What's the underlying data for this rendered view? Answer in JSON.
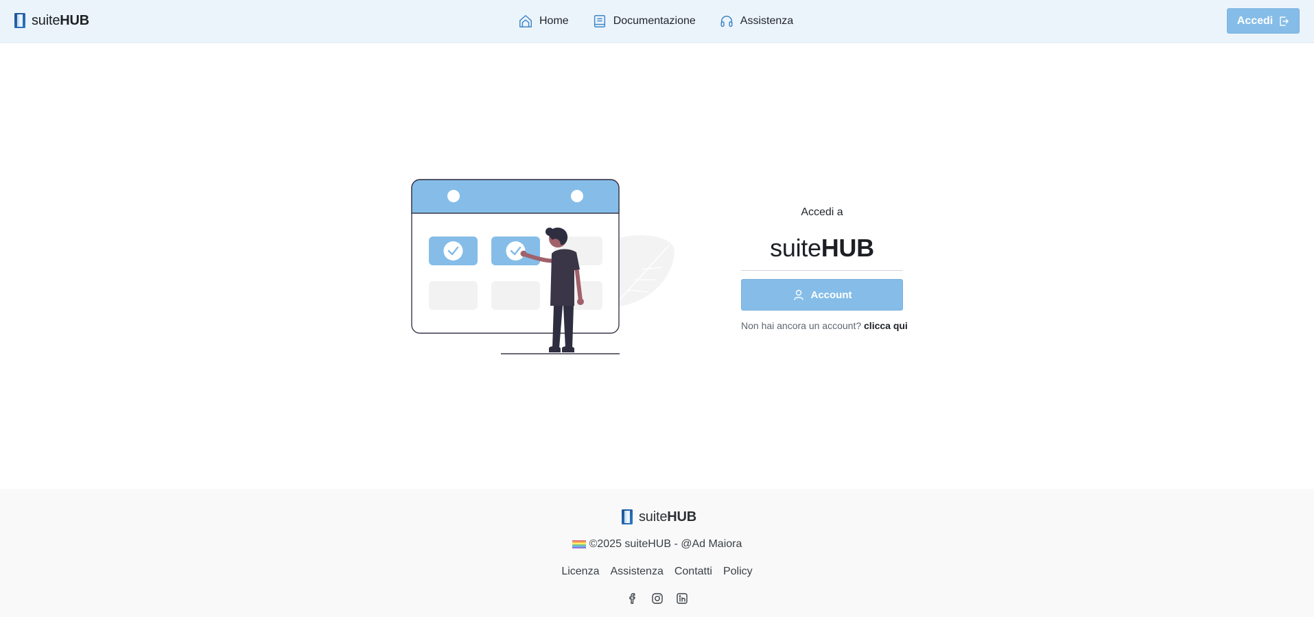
{
  "header": {
    "brand": {
      "name_light": "suite",
      "name_bold": "HUB",
      "icon": "logo-icon"
    },
    "nav": [
      {
        "label": "Home",
        "icon": "home-icon"
      },
      {
        "label": "Documentazione",
        "icon": "book-icon"
      },
      {
        "label": "Assistenza",
        "icon": "headphones-icon"
      }
    ],
    "login_button": {
      "label": "Accedi",
      "icon": "login-icon"
    }
  },
  "login": {
    "subtitle": "Accedi a",
    "title_light": "suite",
    "title_bold": "HUB",
    "account_button": {
      "label": "Account",
      "icon": "user-icon"
    },
    "signup_prompt": "Non hai ancora un account?",
    "signup_link": "clicca qui"
  },
  "footer": {
    "brand": {
      "name_light": "suite",
      "name_bold": "HUB"
    },
    "copyright": "©2025 suiteHUB - @Ad Maiora",
    "links": [
      "Licenza",
      "Assistenza",
      "Contatti",
      "Policy"
    ],
    "social": [
      "facebook-icon",
      "instagram-icon",
      "linkedin-icon"
    ]
  },
  "colors": {
    "accent": "#85bde8",
    "header_bg": "#ecf4fb",
    "footer_bg": "#f9f9f9",
    "figure_dark": "#3a3648",
    "figure_skin": "#a0616a"
  }
}
